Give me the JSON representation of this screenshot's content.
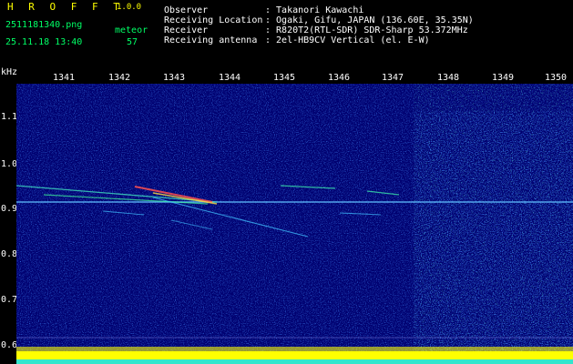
{
  "header": {
    "logo": "H R O F F T",
    "version": "1.0.0",
    "filename": "2511181340.png",
    "datetime": "25.11.18 13:40",
    "meteor_label": "meteor",
    "meteor_count": "57",
    "fields": [
      {
        "label": "Observer",
        "value": ": Takanori Kawachi"
      },
      {
        "label": "Receiving Location",
        "value": ": Ogaki, Gifu, JAPAN (136.60E, 35.35N)"
      },
      {
        "label": "Receiver",
        "value": ": R820T2(RTL-SDR) SDR-Sharp 53.372MHz"
      },
      {
        "label": "Receiving antenna",
        "value": ": 2el-HB9CV Vertical (el. E-W)"
      }
    ]
  },
  "spectrogram": {
    "y_unit": "kHz",
    "x_ticks": [
      "1341",
      "1342",
      "1343",
      "1344",
      "1345",
      "1346",
      "1347",
      "1348",
      "1349",
      "1350"
    ],
    "y_ticks": [
      "1.1",
      "1.0",
      "0.9",
      "0.8",
      "0.7",
      "0.6"
    ],
    "colors": {
      "background": "#000080",
      "noise": "#0030d0",
      "signal": "#40ff80",
      "peak": "#ff4040",
      "baseline": "#ffff00"
    }
  }
}
